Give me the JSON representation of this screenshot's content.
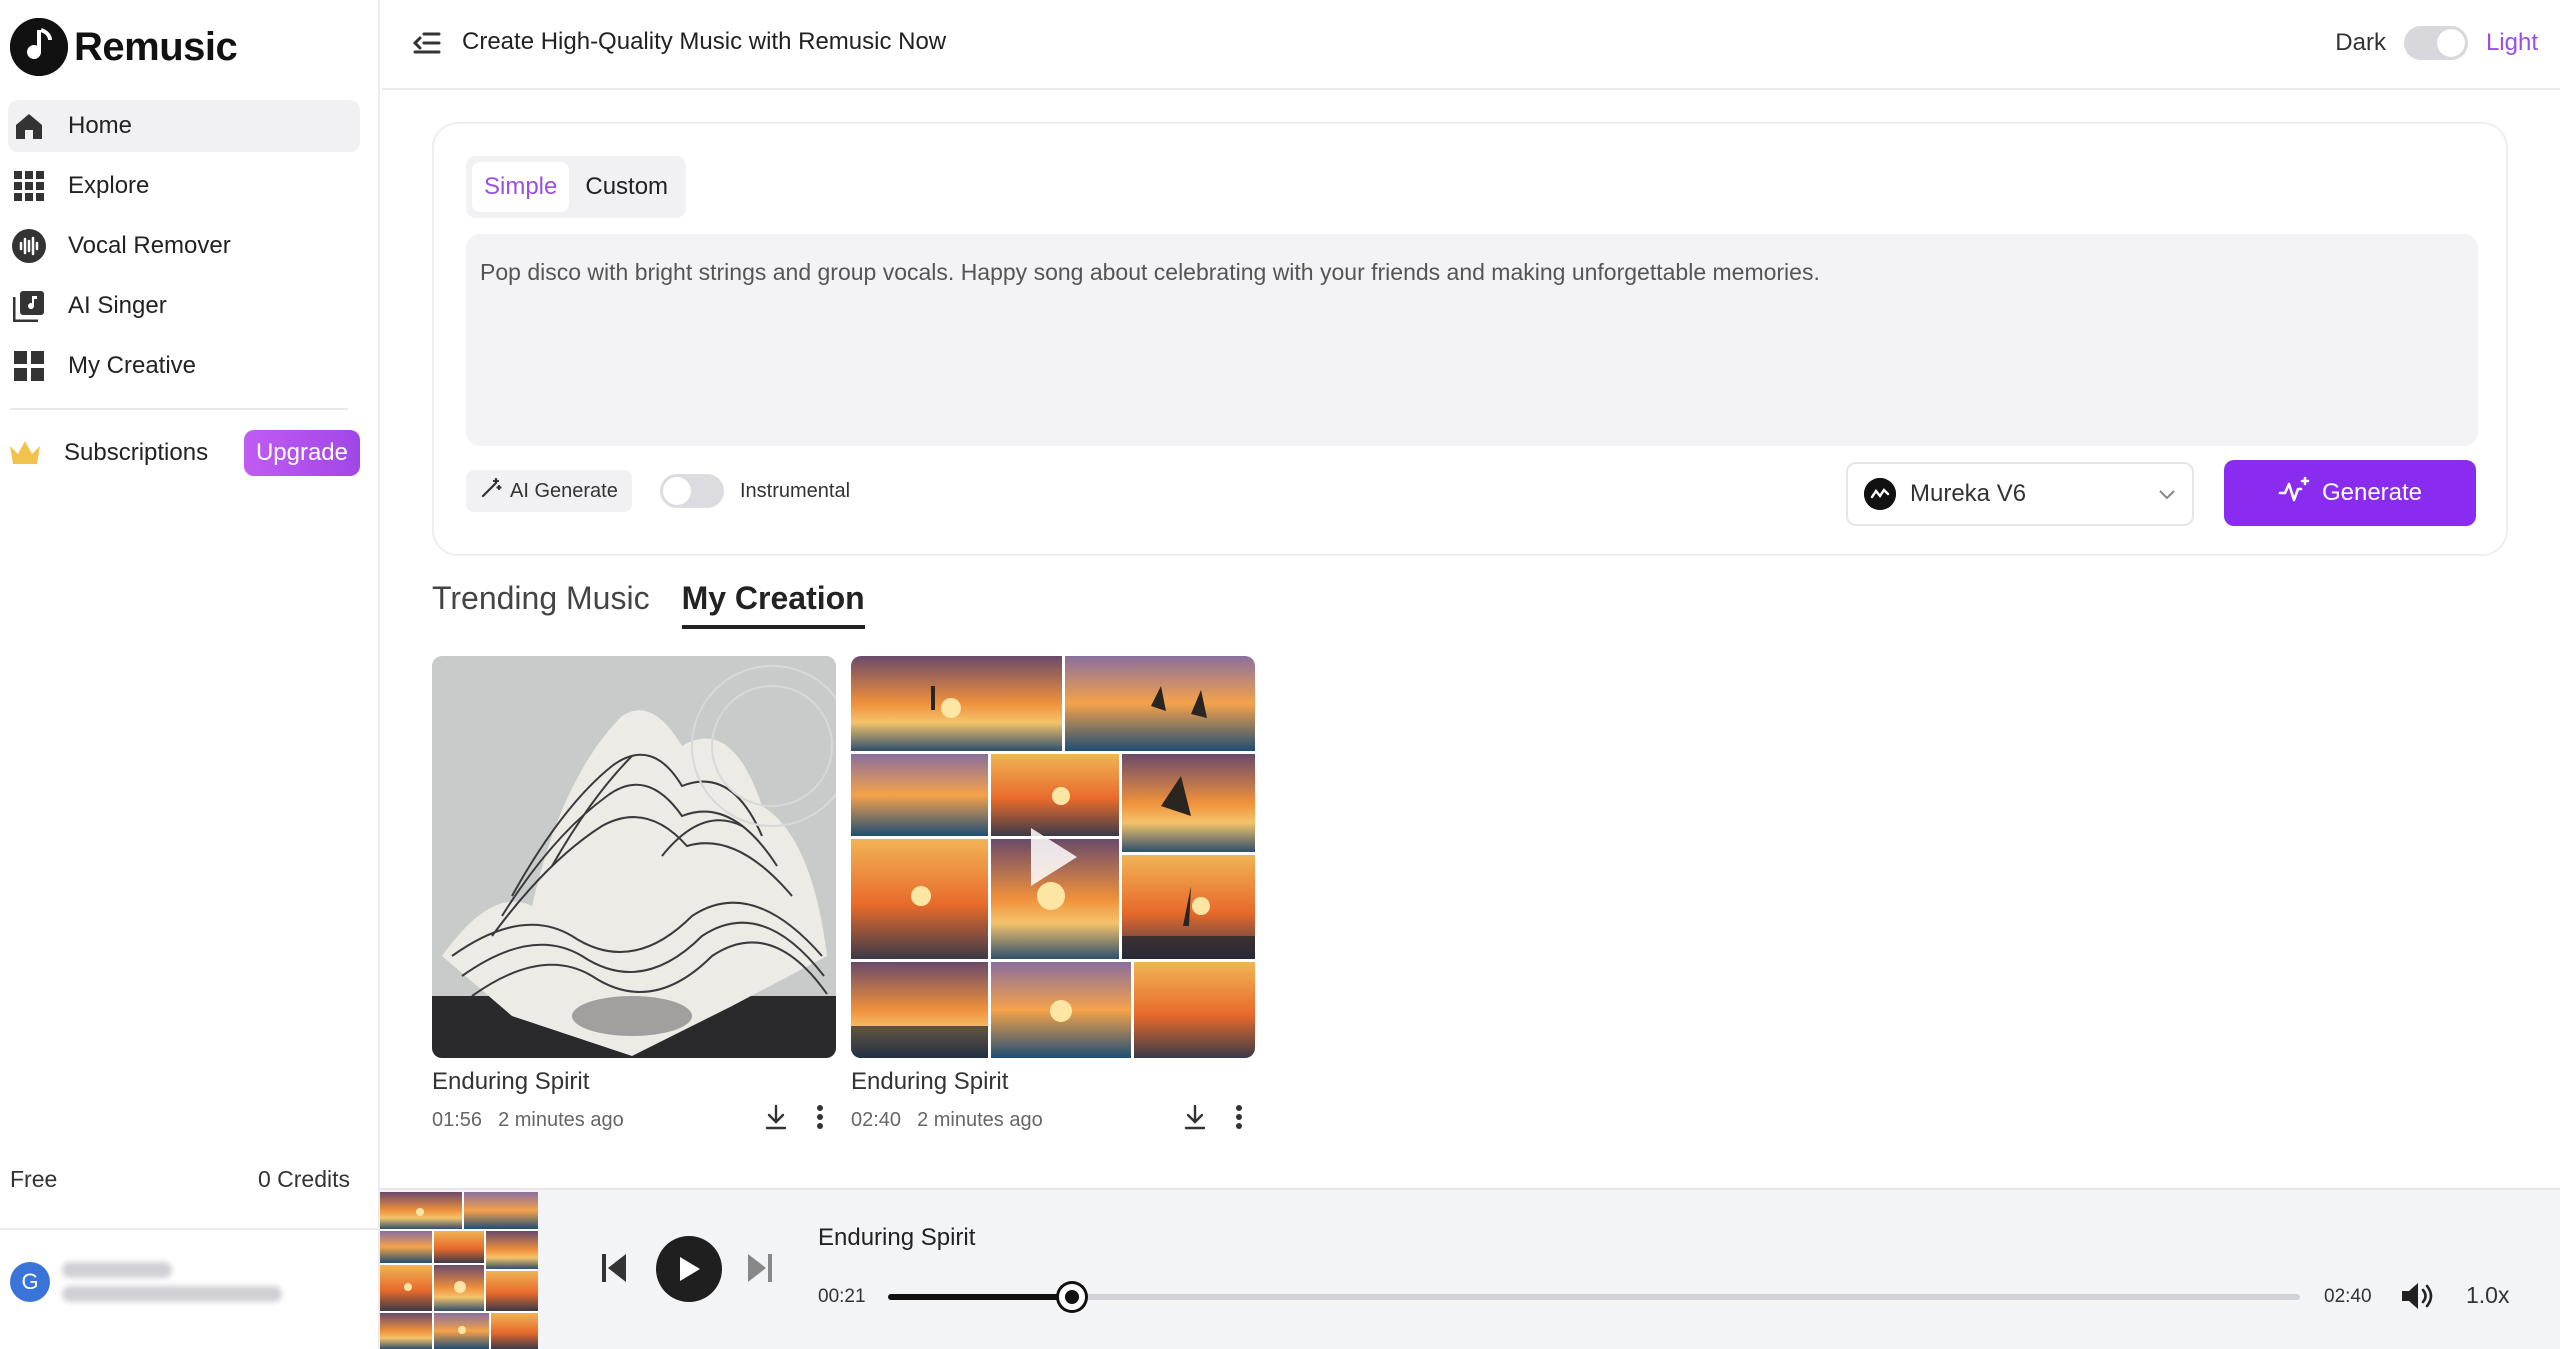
{
  "app": {
    "name": "Remusic"
  },
  "sidebar": {
    "items": [
      {
        "label": "Home",
        "icon": "home-icon",
        "active": true
      },
      {
        "label": "Explore",
        "icon": "grid-icon"
      },
      {
        "label": "Vocal Remover",
        "icon": "waveform-icon"
      },
      {
        "label": "AI Singer",
        "icon": "music-library-icon"
      },
      {
        "label": "My Creative",
        "icon": "dashboard-icon"
      }
    ],
    "subscriptions": {
      "label": "Subscriptions",
      "icon": "crown-icon",
      "upgrade_label": "Upgrade"
    },
    "plan": "Free",
    "credits": "0 Credits",
    "user": {
      "avatar_letter": "G"
    }
  },
  "header": {
    "title": "Create High-Quality Music with Remusic Now",
    "theme_dark": "Dark",
    "theme_light": "Light"
  },
  "composer": {
    "tabs": [
      "Simple",
      "Custom"
    ],
    "active_tab": "Simple",
    "prompt": "Pop disco with bright strings and group vocals. Happy song about celebrating with your friends and making unforgettable memories.",
    "ai_generate_label": "AI Generate",
    "instrumental_label": "Instrumental",
    "instrumental_on": false,
    "model": "Mureka V6",
    "generate_label": "Generate",
    "accent_color": "#8a2cf0"
  },
  "section_tabs": [
    "Trending Music",
    "My Creation"
  ],
  "active_section": "My Creation",
  "creations": [
    {
      "title": "Enduring Spirit",
      "duration": "01:56",
      "age": "2 minutes ago"
    },
    {
      "title": "Enduring Spirit",
      "duration": "02:40",
      "age": "2 minutes ago"
    }
  ],
  "player": {
    "title": "Enduring Spirit",
    "current": "00:21",
    "total": "02:40",
    "progress": 0.13,
    "speed": "1.0x"
  }
}
